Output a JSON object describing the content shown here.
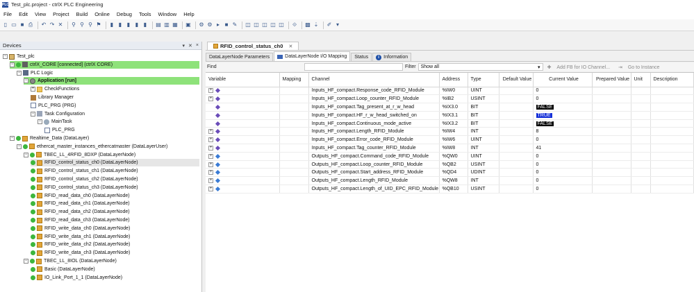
{
  "window": {
    "title": "Test_plc.project - ctrlX PLC Engineering"
  },
  "menu": [
    "File",
    "Edit",
    "View",
    "Project",
    "Build",
    "Online",
    "Debug",
    "Tools",
    "Window",
    "Help"
  ],
  "devices_panel": {
    "title": "Devices",
    "controls": [
      "▾",
      "✕",
      "×"
    ],
    "tree": [
      {
        "level": 0,
        "label": "Test_plc",
        "icon": "project-icon",
        "expander": "-"
      },
      {
        "level": 1,
        "label": "ctrlX_CORE [connected] (ctrlX CORE)",
        "icon": "device-icon",
        "expander": "-",
        "status": "green",
        "highlight": "green"
      },
      {
        "level": 2,
        "label": "PLC Logic",
        "icon": "plc-logic-icon",
        "expander": "-"
      },
      {
        "level": 3,
        "label": "Application [run]",
        "icon": "application-icon",
        "expander": "-",
        "highlight": "green",
        "bold": true
      },
      {
        "level": 4,
        "label": "CheckFunctions",
        "icon": "folder-icon",
        "expander": "+"
      },
      {
        "level": 4,
        "label": "Library Manager",
        "icon": "library-icon"
      },
      {
        "level": 4,
        "label": "PLC_PRG (PRG)",
        "icon": "program-icon"
      },
      {
        "level": 4,
        "label": "Task Configuration",
        "icon": "task-config-icon",
        "expander": "-"
      },
      {
        "level": 5,
        "label": "MainTask",
        "icon": "task-icon",
        "expander": "-"
      },
      {
        "level": 6,
        "label": "PLC_PRG",
        "icon": "program-icon"
      },
      {
        "level": 1,
        "label": "Realtime_Data (DataLayer)",
        "icon": "datalayer-icon",
        "expander": "-",
        "status": "green"
      },
      {
        "level": 2,
        "label": "ethercat_master_instances_ethercatmaster (DataLayerUser)",
        "icon": "datalayer-user-icon",
        "expander": "-",
        "status": "green"
      },
      {
        "level": 3,
        "label": "TBEC_LL_4RFID_8DXP (DataLayerNode)",
        "icon": "datalayer-node-icon",
        "expander": "-",
        "status": "green"
      },
      {
        "level": 4,
        "label": "RFID_control_status_ch0 (DataLayerNode)",
        "icon": "datalayer-node-icon",
        "status": "green",
        "highlight": "grey"
      },
      {
        "level": 4,
        "label": "RFID_control_status_ch1 (DataLayerNode)",
        "icon": "datalayer-node-icon",
        "status": "green"
      },
      {
        "level": 4,
        "label": "RFID_control_status_ch2 (DataLayerNode)",
        "icon": "datalayer-node-icon",
        "status": "green"
      },
      {
        "level": 4,
        "label": "RFID_control_status_ch3 (DataLayerNode)",
        "icon": "datalayer-node-icon",
        "status": "green"
      },
      {
        "level": 4,
        "label": "RFID_read_data_ch0 (DataLayerNode)",
        "icon": "datalayer-node-icon",
        "status": "green"
      },
      {
        "level": 4,
        "label": "RFID_read_data_ch1 (DataLayerNode)",
        "icon": "datalayer-node-icon",
        "status": "green"
      },
      {
        "level": 4,
        "label": "RFID_read_data_ch2 (DataLayerNode)",
        "icon": "datalayer-node-icon",
        "status": "green"
      },
      {
        "level": 4,
        "label": "RFID_read_data_ch3 (DataLayerNode)",
        "icon": "datalayer-node-icon",
        "status": "green"
      },
      {
        "level": 4,
        "label": "RFID_write_data_ch0 (DataLayerNode)",
        "icon": "datalayer-node-icon",
        "status": "green"
      },
      {
        "level": 4,
        "label": "RFID_write_data_ch1 (DataLayerNode)",
        "icon": "datalayer-node-icon",
        "status": "green"
      },
      {
        "level": 4,
        "label": "RFID_write_data_ch2 (DataLayerNode)",
        "icon": "datalayer-node-icon",
        "status": "green"
      },
      {
        "level": 4,
        "label": "RFID_write_data_ch3 (DataLayerNode)",
        "icon": "datalayer-node-icon",
        "status": "green"
      },
      {
        "level": 3,
        "label": "TBEC_LL_8IOL (DataLayerNode)",
        "icon": "datalayer-node-icon",
        "expander": "-",
        "status": "green"
      },
      {
        "level": 4,
        "label": "Basic (DataLayerNode)",
        "icon": "datalayer-node-icon",
        "status": "green"
      },
      {
        "level": 4,
        "label": "IO_Link_Port_1_1 (DataLayerNode)",
        "icon": "datalayer-node-icon",
        "status": "green"
      }
    ]
  },
  "editor": {
    "doc_tab": "RFID_control_status_ch0",
    "subtabs": [
      {
        "label": "DataLayerNode Parameters",
        "active": false,
        "icon": ""
      },
      {
        "label": "DataLayerNode I/O Mapping",
        "active": true,
        "icon": "grid"
      },
      {
        "label": "Status",
        "active": false,
        "icon": ""
      },
      {
        "label": "Information",
        "active": false,
        "icon": "info"
      }
    ],
    "find_label": "Find",
    "filter_label": "Filter",
    "filter_value": "Show all",
    "add_fb_label": "Add FB for IO Channel...",
    "goto_label": "Go to Instance",
    "columns": [
      "Variable",
      "Mapping",
      "Channel",
      "Address",
      "Type",
      "Default Value",
      "Current Value",
      "Prepared Value",
      "Unit",
      "Description"
    ],
    "rows": [
      {
        "dir": "in",
        "expander": "+",
        "channel": "Inputs_HF_compact.Response_code_RFID_Module",
        "address": "%IW0",
        "type": "UINT",
        "current": "0",
        "kind": "num"
      },
      {
        "dir": "in",
        "expander": "+",
        "channel": "Inputs_HF_compact.Loop_counter_RFID_Module",
        "address": "%IB2",
        "type": "USINT",
        "current": "0",
        "kind": "num"
      },
      {
        "dir": "in",
        "expander": "",
        "channel": "Inputs_HF_compact.Tag_present_at_r_w_head",
        "address": "%IX3.0",
        "type": "BIT",
        "current": "FALSE",
        "kind": "false"
      },
      {
        "dir": "in",
        "expander": "",
        "channel": "Inputs_HF_compact.HF_r_w_head_switched_on",
        "address": "%IX3.1",
        "type": "BIT",
        "current": "TRUE",
        "kind": "true"
      },
      {
        "dir": "in",
        "expander": "",
        "channel": "Inputs_HF_compact.Continuous_mode_active",
        "address": "%IX3.2",
        "type": "BIT",
        "current": "FALSE",
        "kind": "false"
      },
      {
        "dir": "in",
        "expander": "+",
        "channel": "Inputs_HF_compact.Length_RFID_Module",
        "address": "%IW4",
        "type": "INT",
        "current": "8",
        "kind": "num"
      },
      {
        "dir": "in",
        "expander": "+",
        "channel": "Inputs_HF_compact.Error_code_RFID_Module",
        "address": "%IW6",
        "type": "UINT",
        "current": "0",
        "kind": "num"
      },
      {
        "dir": "in",
        "expander": "+",
        "channel": "Inputs_HF_compact.Tag_counter_RFID_Module",
        "address": "%IW8",
        "type": "INT",
        "current": "41",
        "kind": "num"
      },
      {
        "dir": "out",
        "expander": "+",
        "channel": "Outputs_HF_compact.Command_code_RFID_Module",
        "address": "%QW0",
        "type": "UINT",
        "current": "0",
        "kind": "num"
      },
      {
        "dir": "out",
        "expander": "+",
        "channel": "Outputs_HF_compact.Loop_counter_RFID_Module",
        "address": "%QB2",
        "type": "USINT",
        "current": "0",
        "kind": "num"
      },
      {
        "dir": "out",
        "expander": "+",
        "channel": "Outputs_HF_compact.Start_address_RFID_Module",
        "address": "%QD4",
        "type": "UDINT",
        "current": "0",
        "kind": "num"
      },
      {
        "dir": "out",
        "expander": "+",
        "channel": "Outputs_HF_compact.Length_RFID_Module",
        "address": "%QW8",
        "type": "INT",
        "current": "0",
        "kind": "num"
      },
      {
        "dir": "out",
        "expander": "+",
        "channel": "Outputs_HF_compact.Length_of_UID_EPC_RFID_Module",
        "address": "%QB10",
        "type": "USINT",
        "current": "0",
        "kind": "num"
      }
    ]
  },
  "colors": {
    "highlight_green": "#8ee27a",
    "status_green": "#3db63d",
    "bool_true_bg": "#1530d8",
    "bool_false_bg": "#000000"
  }
}
